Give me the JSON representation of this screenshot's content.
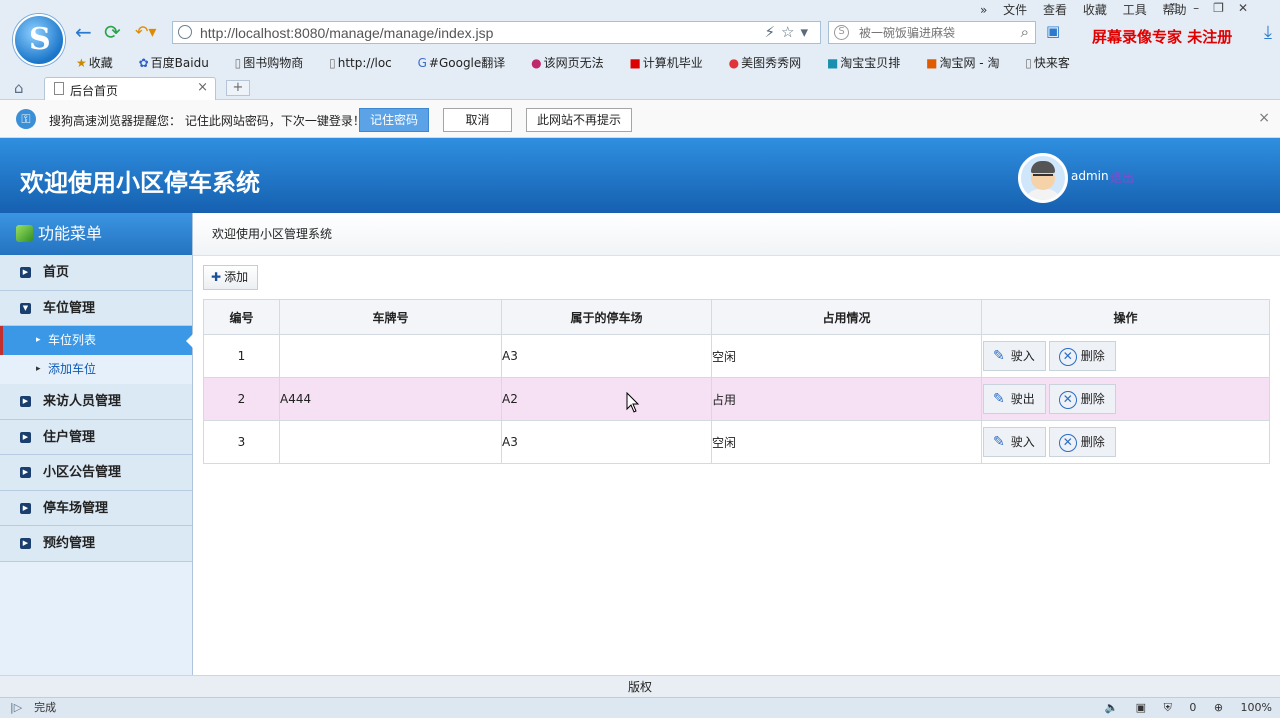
{
  "browser": {
    "menu": [
      "文件",
      "查看",
      "收藏",
      "工具",
      "帮助"
    ],
    "url": "http://localhost:8080/manage/manage/index.jsp",
    "url_host": "localhost:8080",
    "search_placeholder": "被一碗饭骗进麻袋",
    "watermark": "屏幕录像专家 未注册",
    "bookmarks": [
      "收藏",
      "百度Baidu",
      "图书购物商",
      "http://loc",
      "#Google翻译",
      "该网页无法",
      "计算机毕业",
      "美图秀秀网",
      "淘宝宝贝排",
      "淘宝网 - 淘",
      "快来客"
    ],
    "tab_title": "后台首页",
    "status_left": "完成",
    "status_count": "0",
    "zoom": "100%"
  },
  "password_bar": {
    "message": "搜狗高速浏览器提醒您： 记住此网站密码，下次一键登录！",
    "remember": "记住密码",
    "cancel": "取消",
    "never": "此网站不再提示"
  },
  "header": {
    "title": "欢迎使用小区停车系统",
    "user": "admin",
    "logout": "退出"
  },
  "sidebar": {
    "title": "功能菜单",
    "items": [
      {
        "label": "首页"
      },
      {
        "label": "车位管理",
        "children": [
          "车位列表",
          "添加车位"
        ]
      },
      {
        "label": "来访人员管理"
      },
      {
        "label": "住户管理"
      },
      {
        "label": "小区公告管理"
      },
      {
        "label": "停车场管理"
      },
      {
        "label": "预约管理"
      }
    ]
  },
  "main": {
    "breadcrumb": "欢迎使用小区管理系统",
    "add_label": "添加",
    "columns": [
      "编号",
      "车牌号",
      "属于的停车场",
      "占用情况",
      "操作"
    ],
    "rows": [
      {
        "id": "1",
        "plate": "",
        "lot": "A3",
        "status": "空闲",
        "action": "驶入",
        "delete": "删除"
      },
      {
        "id": "2",
        "plate": "A444",
        "lot": "A2",
        "status": "占用",
        "action": "驶出",
        "delete": "删除"
      },
      {
        "id": "3",
        "plate": "",
        "lot": "A3",
        "status": "空闲",
        "action": "驶入",
        "delete": "删除"
      }
    ]
  },
  "footer": {
    "text": "版权"
  }
}
